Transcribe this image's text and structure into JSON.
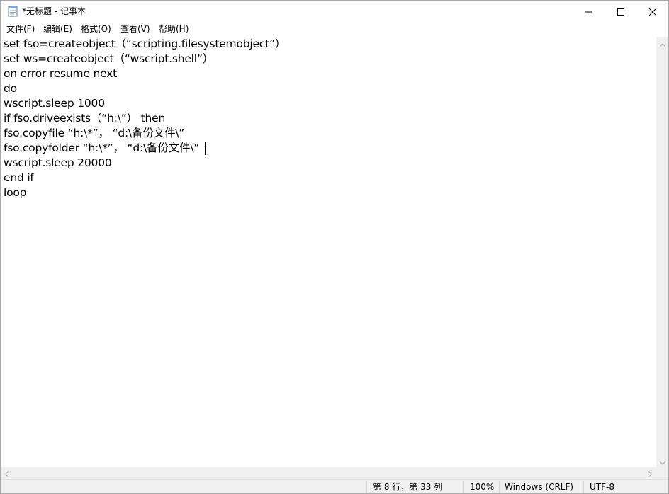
{
  "window": {
    "title": "*无标题 - 记事本"
  },
  "menu": {
    "items": [
      "文件(F)",
      "编辑(E)",
      "格式(O)",
      "查看(V)",
      "帮助(H)"
    ]
  },
  "editor": {
    "lines": [
      "set fso=createobject（“scripting.filesystemobject”）",
      "set ws=createobject（“wscript.shell”）",
      "on error resume next",
      "do",
      "wscript.sleep 1000",
      "if fso.driveexists（“h:\\”） then",
      "fso.copyfile “h:\\*”， “d:\\备份文件\\”",
      "fso.copyfolder “h:\\*”， “d:\\备份文件\\”",
      "wscript.sleep 20000",
      "end if",
      "loop"
    ]
  },
  "statusbar": {
    "position": "第 8 行，第 33 列",
    "zoom": "100%",
    "line_ending": "Windows (CRLF)",
    "encoding": "UTF-8"
  },
  "icons": {
    "app": "notepad-icon",
    "minimize": "minimize-icon",
    "maximize": "maximize-icon",
    "close": "close-icon"
  }
}
